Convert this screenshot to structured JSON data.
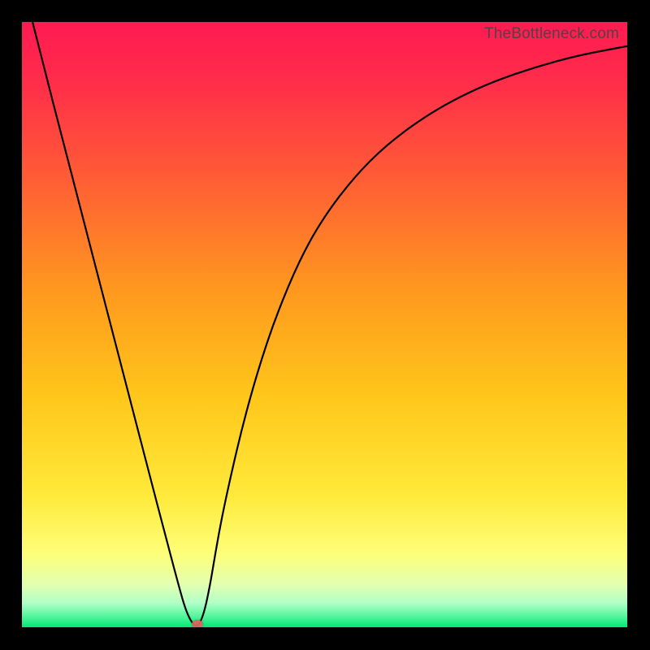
{
  "watermark": "TheBottleneck.com",
  "colors": {
    "frame": "#000000",
    "curve": "#000000",
    "marker": "#d2695f",
    "gradient_top": "#ff1a52",
    "gradient_bottom": "#00e876"
  },
  "chart_data": {
    "type": "line",
    "title": "",
    "xlabel": "",
    "ylabel": "",
    "xlim": [
      0,
      100
    ],
    "ylim": [
      0,
      100
    ],
    "x": [
      0,
      3.5,
      7,
      10.5,
      14,
      17.5,
      21,
      24,
      26,
      27,
      28,
      29,
      30,
      31,
      32,
      33,
      34.5,
      36.5,
      39,
      42,
      46,
      50,
      55,
      60,
      66,
      72,
      78,
      85,
      92,
      100
    ],
    "values": [
      107,
      93,
      79.5,
      66,
      52.5,
      39,
      25.5,
      14,
      6.5,
      3,
      0.8,
      0,
      2,
      6.5,
      12.5,
      18,
      25,
      33.5,
      42.5,
      51.5,
      61,
      68,
      74.5,
      79.5,
      84,
      87.5,
      90.2,
      92.6,
      94.5,
      96
    ],
    "marker": {
      "x": 29,
      "y": 0.5
    }
  }
}
